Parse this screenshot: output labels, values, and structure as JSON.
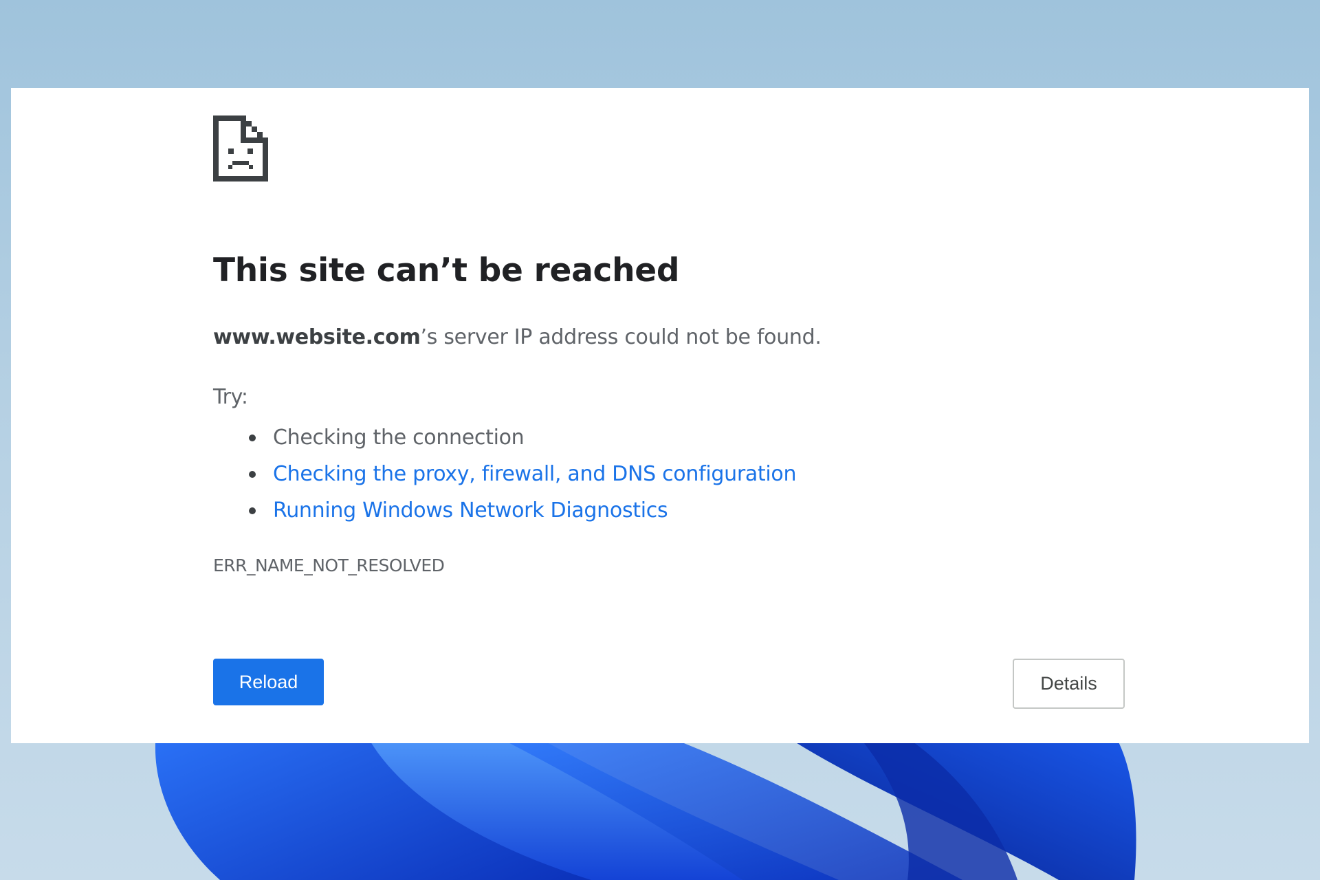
{
  "colors": {
    "link": "#1a73e8",
    "primary_button": "#1a73e8",
    "title": "#202124",
    "body_text": "#5f6368"
  },
  "error_page": {
    "icon": "sad-page-icon",
    "title": "This site can’t be reached",
    "message_host": "www.website.com",
    "message_rest": "’s server IP address could not be found.",
    "try_label": "Try:",
    "suggestions": [
      "Checking the connection",
      "Checking the proxy, firewall, and DNS configuration",
      "Running Windows Network Diagnostics"
    ],
    "error_code": "ERR_NAME_NOT_RESOLVED",
    "reload_label": "Reload",
    "details_label": "Details"
  }
}
